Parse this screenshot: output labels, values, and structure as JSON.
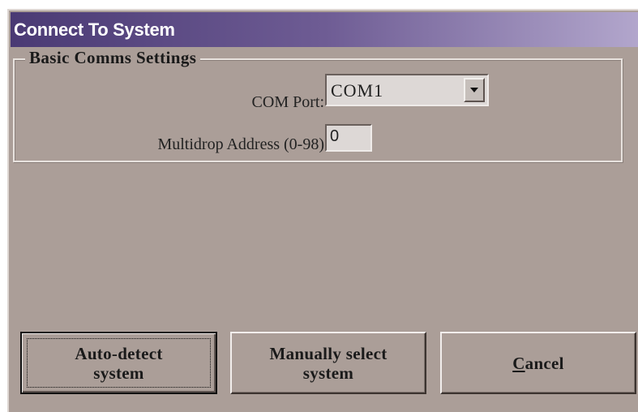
{
  "window": {
    "title": "Connect To System"
  },
  "group": {
    "legend": "Basic Comms Settings",
    "com_port_label": "COM Port:",
    "com_port_value": "COM1",
    "multidrop_label": "Multidrop Address (0-98)",
    "multidrop_value": "0"
  },
  "buttons": {
    "auto_detect": "Auto-detect\nsystem",
    "manual_select": "Manually select\nsystem",
    "cancel_accel": "C",
    "cancel_rest": "ancel"
  },
  "colors": {
    "dialog_bg": "#ab9e98",
    "titlebar_start": "#4a3a74",
    "titlebar_end": "#b2a6cc"
  }
}
